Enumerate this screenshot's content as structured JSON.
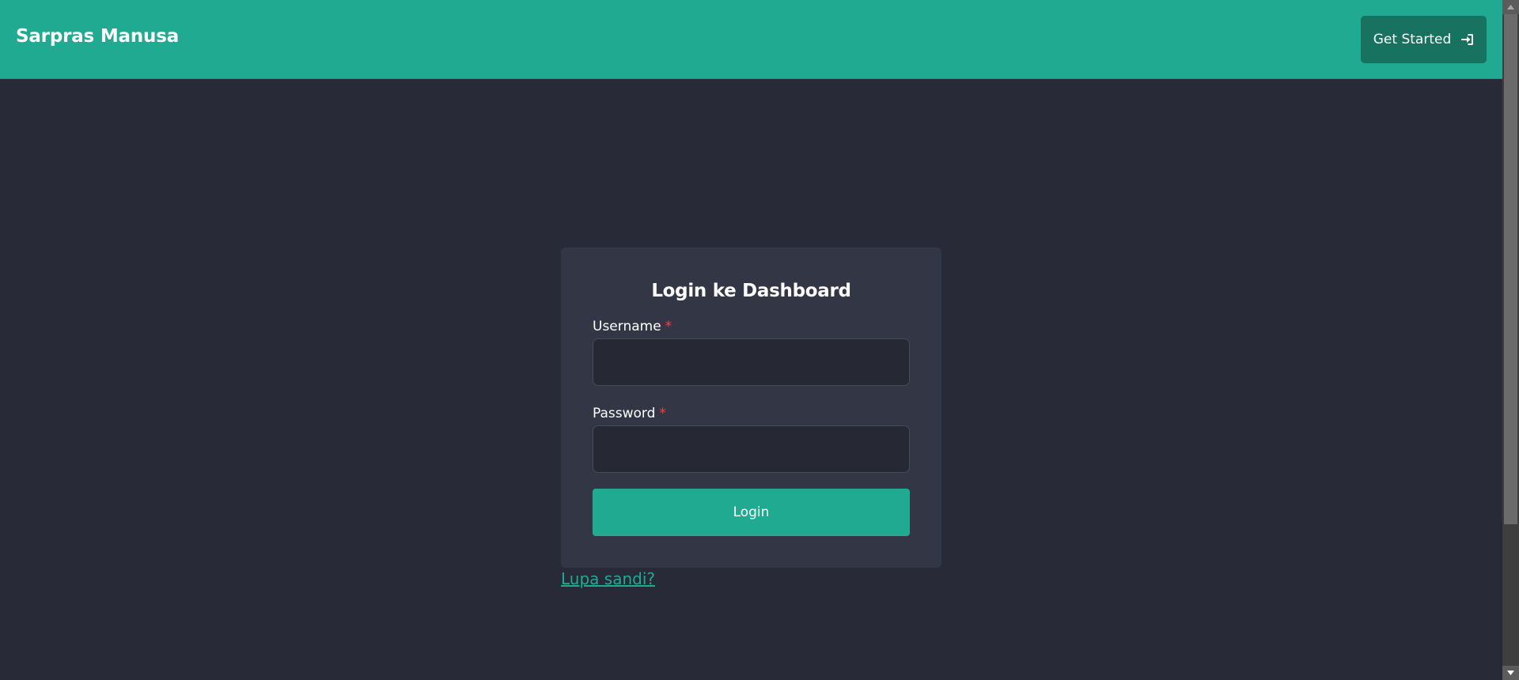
{
  "navbar": {
    "brand": "Sarpras Manusa",
    "get_started_label": "Get Started",
    "get_started_icon": "sign-in-icon",
    "background_color": "#20aa92",
    "button_color": "#17725f"
  },
  "login_card": {
    "title": "Login ke Dashboard",
    "username_label": "Username",
    "username_required_mark": "*",
    "username_value": "",
    "password_label": "Password",
    "password_required_mark": "*",
    "password_value": "",
    "submit_label": "Login",
    "card_color": "#333645",
    "accent_color": "#20aa92",
    "required_color": "#e5484d"
  },
  "forgot_password_link": "Lupa sandi?",
  "page_background": "#282b37"
}
